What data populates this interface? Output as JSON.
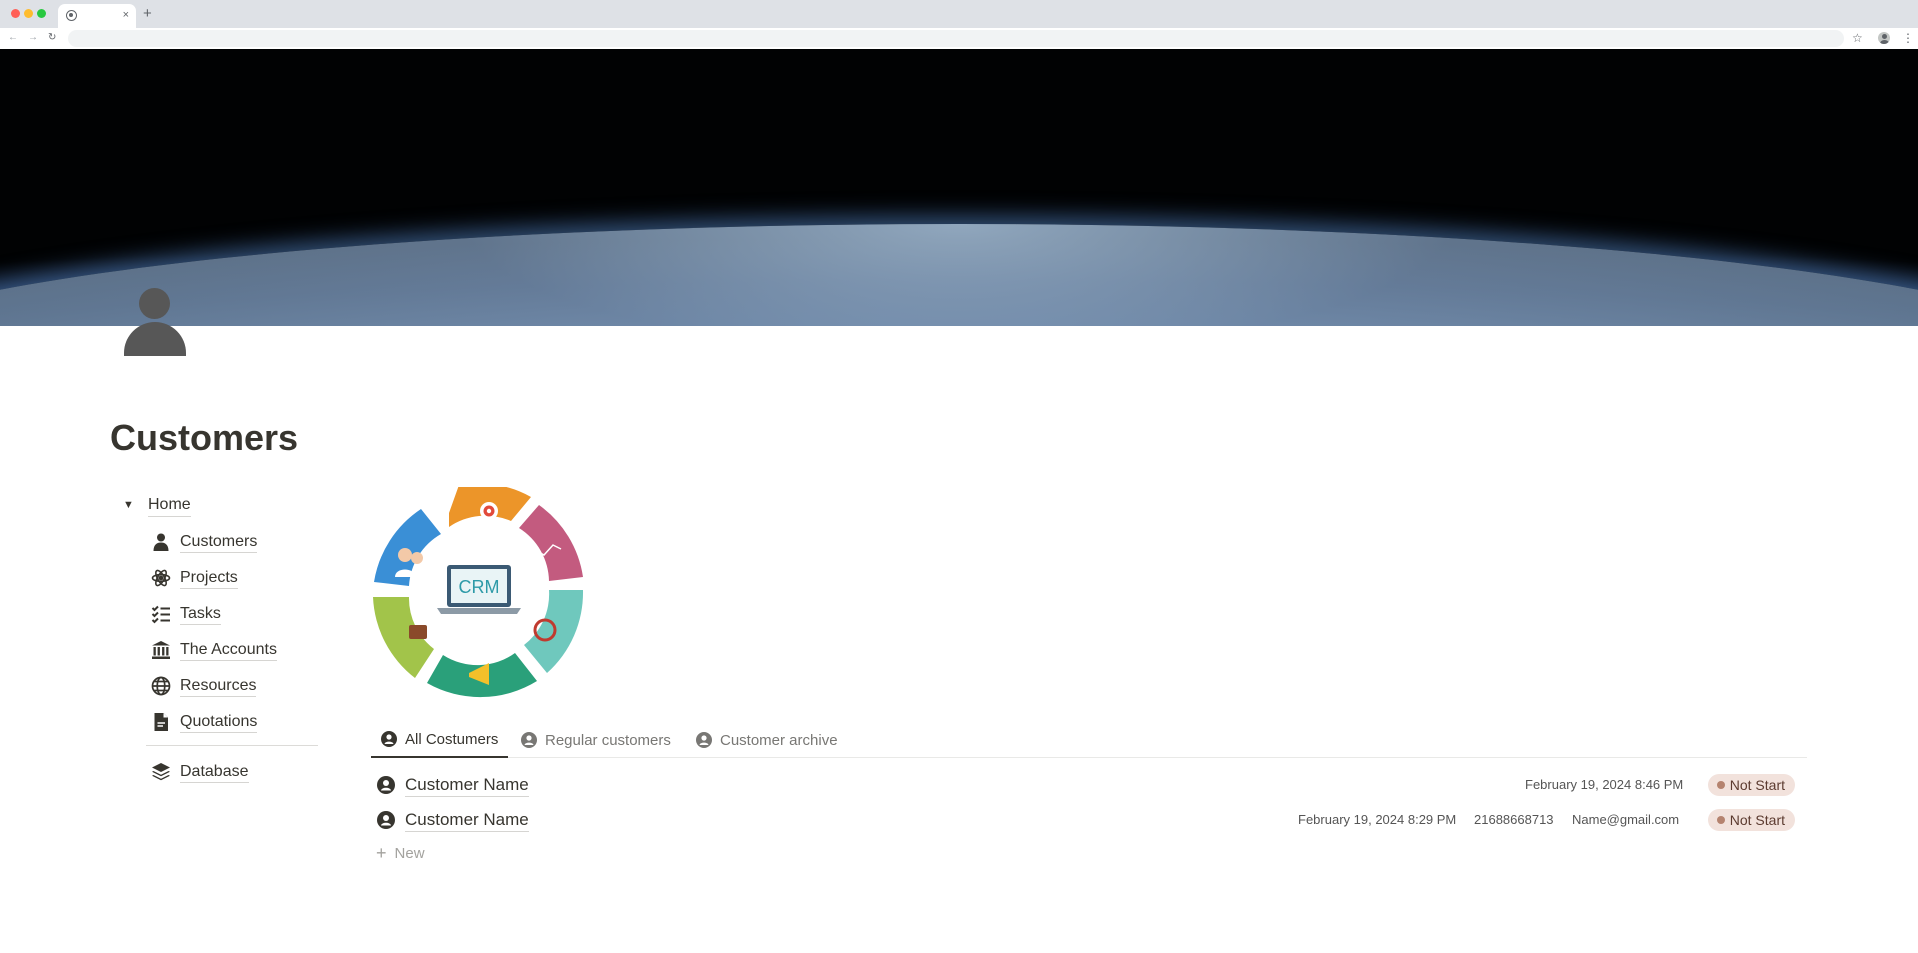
{
  "browser": {
    "tab_close": "×",
    "new_tab": "+",
    "back": "←",
    "forward": "→",
    "reload": "↻",
    "star": "☆",
    "menu": "⋮"
  },
  "page": {
    "title": "Customers",
    "icon": "person-icon"
  },
  "nav": {
    "toggle": "▼",
    "home": "Home",
    "items": [
      {
        "label": "Customers",
        "icon": "person-icon"
      },
      {
        "label": "Projects",
        "icon": "atom-icon"
      },
      {
        "label": "Tasks",
        "icon": "checklist-icon"
      },
      {
        "label": "The Accounts",
        "icon": "bank-icon"
      },
      {
        "label": "Resources",
        "icon": "globe-icon"
      },
      {
        "label": "Quotations",
        "icon": "document-icon"
      }
    ],
    "database": {
      "label": "Database",
      "icon": "layers-icon"
    }
  },
  "crm": {
    "center_label": "CRM",
    "colors": {
      "orange": "#ec9529",
      "pink": "#c35b7f",
      "teal": "#6fc8bd",
      "green": "#2aa07a",
      "lime": "#a2c44a",
      "blue": "#3a8fd6"
    }
  },
  "views": {
    "tabs": [
      {
        "label": "All Costumers",
        "active": true
      },
      {
        "label": "Regular customers",
        "active": false
      },
      {
        "label": "Customer archive",
        "active": false
      }
    ]
  },
  "rows": [
    {
      "name": "Customer Name",
      "date": "February 19, 2024 8:46 PM",
      "phone": "",
      "email": "",
      "status": "Not Start"
    },
    {
      "name": "Customer Name",
      "date": "February 19, 2024 8:29 PM",
      "phone": "21688668713",
      "email": "Name@gmail.com",
      "status": "Not Start"
    }
  ],
  "new_row": {
    "plus": "+",
    "label": "New"
  }
}
